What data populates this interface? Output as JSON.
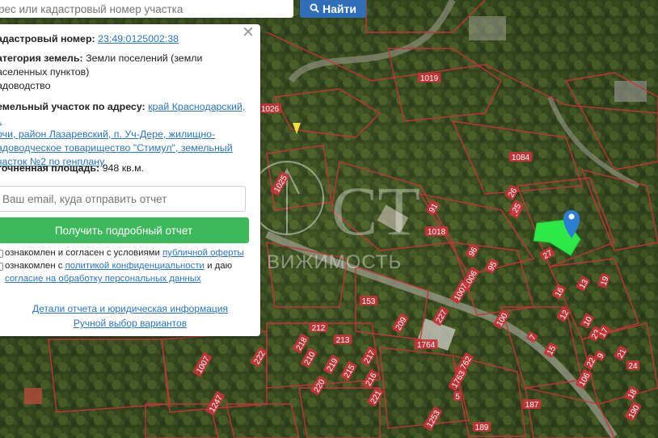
{
  "search": {
    "placeholder": "рес или кадастровый номер участка",
    "button_label": "Найти"
  },
  "panel": {
    "cadastral_label": "адастровый номер:",
    "cadastral_number": "23:49:0125002:38",
    "category_label": "атегория земель:",
    "category_value_1": "Земли поселений (земли",
    "category_value_2": "аселенных пунктов)",
    "category_value_3": "адоводство",
    "address_label": "емельный участок по адресу:",
    "address_1": "край Краснодарский, г.",
    "address_2": "очи, район Лазаревский, п. Уч-Дере, жилищно-",
    "address_3": "адоводческое товарищество \"Стимул\", земельный",
    "address_4": "часток №2 по генплану",
    "area_label": "точненная площадь:",
    "area_value": "948 кв.м.",
    "email_placeholder": "Ваш email, куда отправить отчет",
    "report_button": "Получить подробный отчет",
    "agree1_text": "ознакомлен и согласен с условиями",
    "agree1_link": "публичной оферты",
    "agree2_text": "ознакомлен с",
    "agree2_link": "политикой конфиденциальности",
    "agree2_tail": "и даю",
    "agree3_link": "согласие на обработку персональных данных",
    "details_link": "Детали отчета и юридическая информация",
    "manual_link": "Ручной выбор вариантов"
  },
  "map": {
    "watermark": "СТ",
    "watermark_sub": "ВИЖИМОСТЬ",
    "marker_color": "#2a7fd4",
    "highlight_color": "#2ee84a",
    "parcel_labels": [
      {
        "t": "1019"
      },
      {
        "t": "1026"
      },
      {
        "t": "1084"
      },
      {
        "t": "1018"
      },
      {
        "t": "25"
      },
      {
        "t": "27"
      },
      {
        "t": "19"
      },
      {
        "t": "16"
      },
      {
        "t": "13"
      },
      {
        "t": "12"
      },
      {
        "t": "10"
      },
      {
        "t": "96"
      },
      {
        "t": "95"
      },
      {
        "t": "1006"
      },
      {
        "t": "1007"
      },
      {
        "t": "153"
      },
      {
        "t": "100"
      },
      {
        "t": "7"
      },
      {
        "t": "15"
      },
      {
        "t": "23"
      },
      {
        "t": "9"
      },
      {
        "t": "24"
      },
      {
        "t": "212"
      },
      {
        "t": "213"
      },
      {
        "t": "217"
      },
      {
        "t": "210"
      },
      {
        "t": "215"
      },
      {
        "t": "216"
      },
      {
        "t": "1764"
      },
      {
        "t": "1762"
      },
      {
        "t": "1763"
      },
      {
        "t": "1007"
      },
      {
        "t": "1247"
      },
      {
        "t": "187"
      },
      {
        "t": "189"
      },
      {
        "t": "209"
      },
      {
        "t": "222"
      },
      {
        "t": "218"
      },
      {
        "t": "219"
      },
      {
        "t": "220"
      },
      {
        "t": "221"
      },
      {
        "t": "227"
      },
      {
        "t": "1253"
      },
      {
        "t": "5"
      },
      {
        "t": "106"
      },
      {
        "t": "17"
      },
      {
        "t": "21"
      },
      {
        "t": "22"
      },
      {
        "t": "18"
      },
      {
        "t": "190"
      },
      {
        "t": "91"
      },
      {
        "t": "26"
      },
      {
        "t": "1025"
      },
      {
        "t": "25"
      }
    ]
  }
}
